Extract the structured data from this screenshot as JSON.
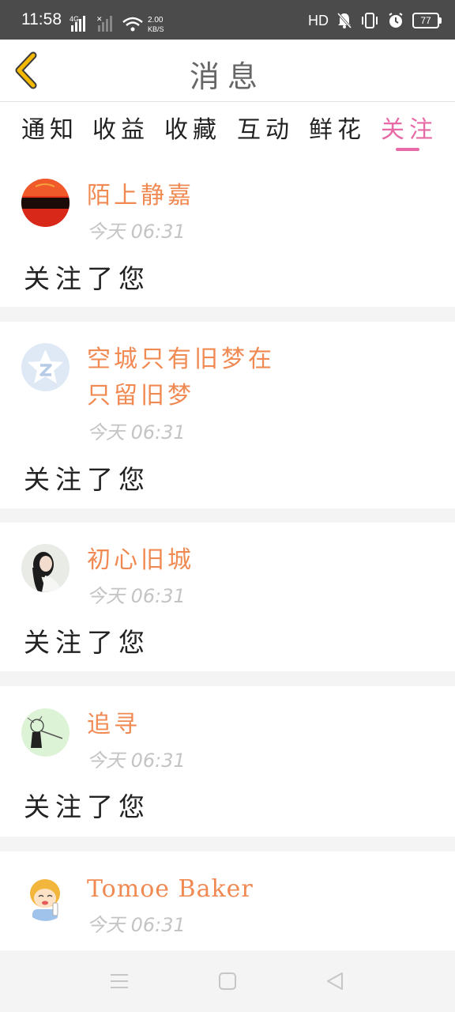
{
  "status_bar": {
    "time": "11:58",
    "net_type": "4G",
    "speed_value": "2.00",
    "speed_unit": "KB/S",
    "hd_label": "HD",
    "battery": "77"
  },
  "header": {
    "title": "消息",
    "back_icon": "chevron-left-icon",
    "back_color": "#f5b800"
  },
  "tabs": [
    {
      "label": "通知",
      "active": false
    },
    {
      "label": "收益",
      "active": false
    },
    {
      "label": "收藏",
      "active": false
    },
    {
      "label": "互动",
      "active": false
    },
    {
      "label": "鲜花",
      "active": false
    },
    {
      "label": "关注",
      "active": true
    }
  ],
  "colors": {
    "accent": "#e76aa6",
    "name": "#f08a52",
    "time": "#c4c4c4",
    "separator": "#f4f4f4"
  },
  "notifications": [
    {
      "name": "陌上静嘉",
      "time": "今天 06:31",
      "message": "关注了您",
      "avatar": "sunset-avatar"
    },
    {
      "name_line1": "空城只有旧梦在",
      "name_line2": "只留旧梦",
      "time": "今天 06:31",
      "message": "关注了您",
      "avatar": "qq-star-avatar"
    },
    {
      "name": "初心旧城",
      "time": "今天 06:31",
      "message": "关注了您",
      "avatar": "girl-photo-avatar"
    },
    {
      "name": "追寻",
      "time": "今天 06:31",
      "message": "关注了您",
      "avatar": "sketch-avatar"
    },
    {
      "name": "Tomoe Baker",
      "time": "今天 06:31",
      "avatar": "cartoon-avatar"
    }
  ],
  "nav_bar": {
    "items": [
      "menu-icon",
      "home-square-icon",
      "back-triangle-icon"
    ]
  }
}
